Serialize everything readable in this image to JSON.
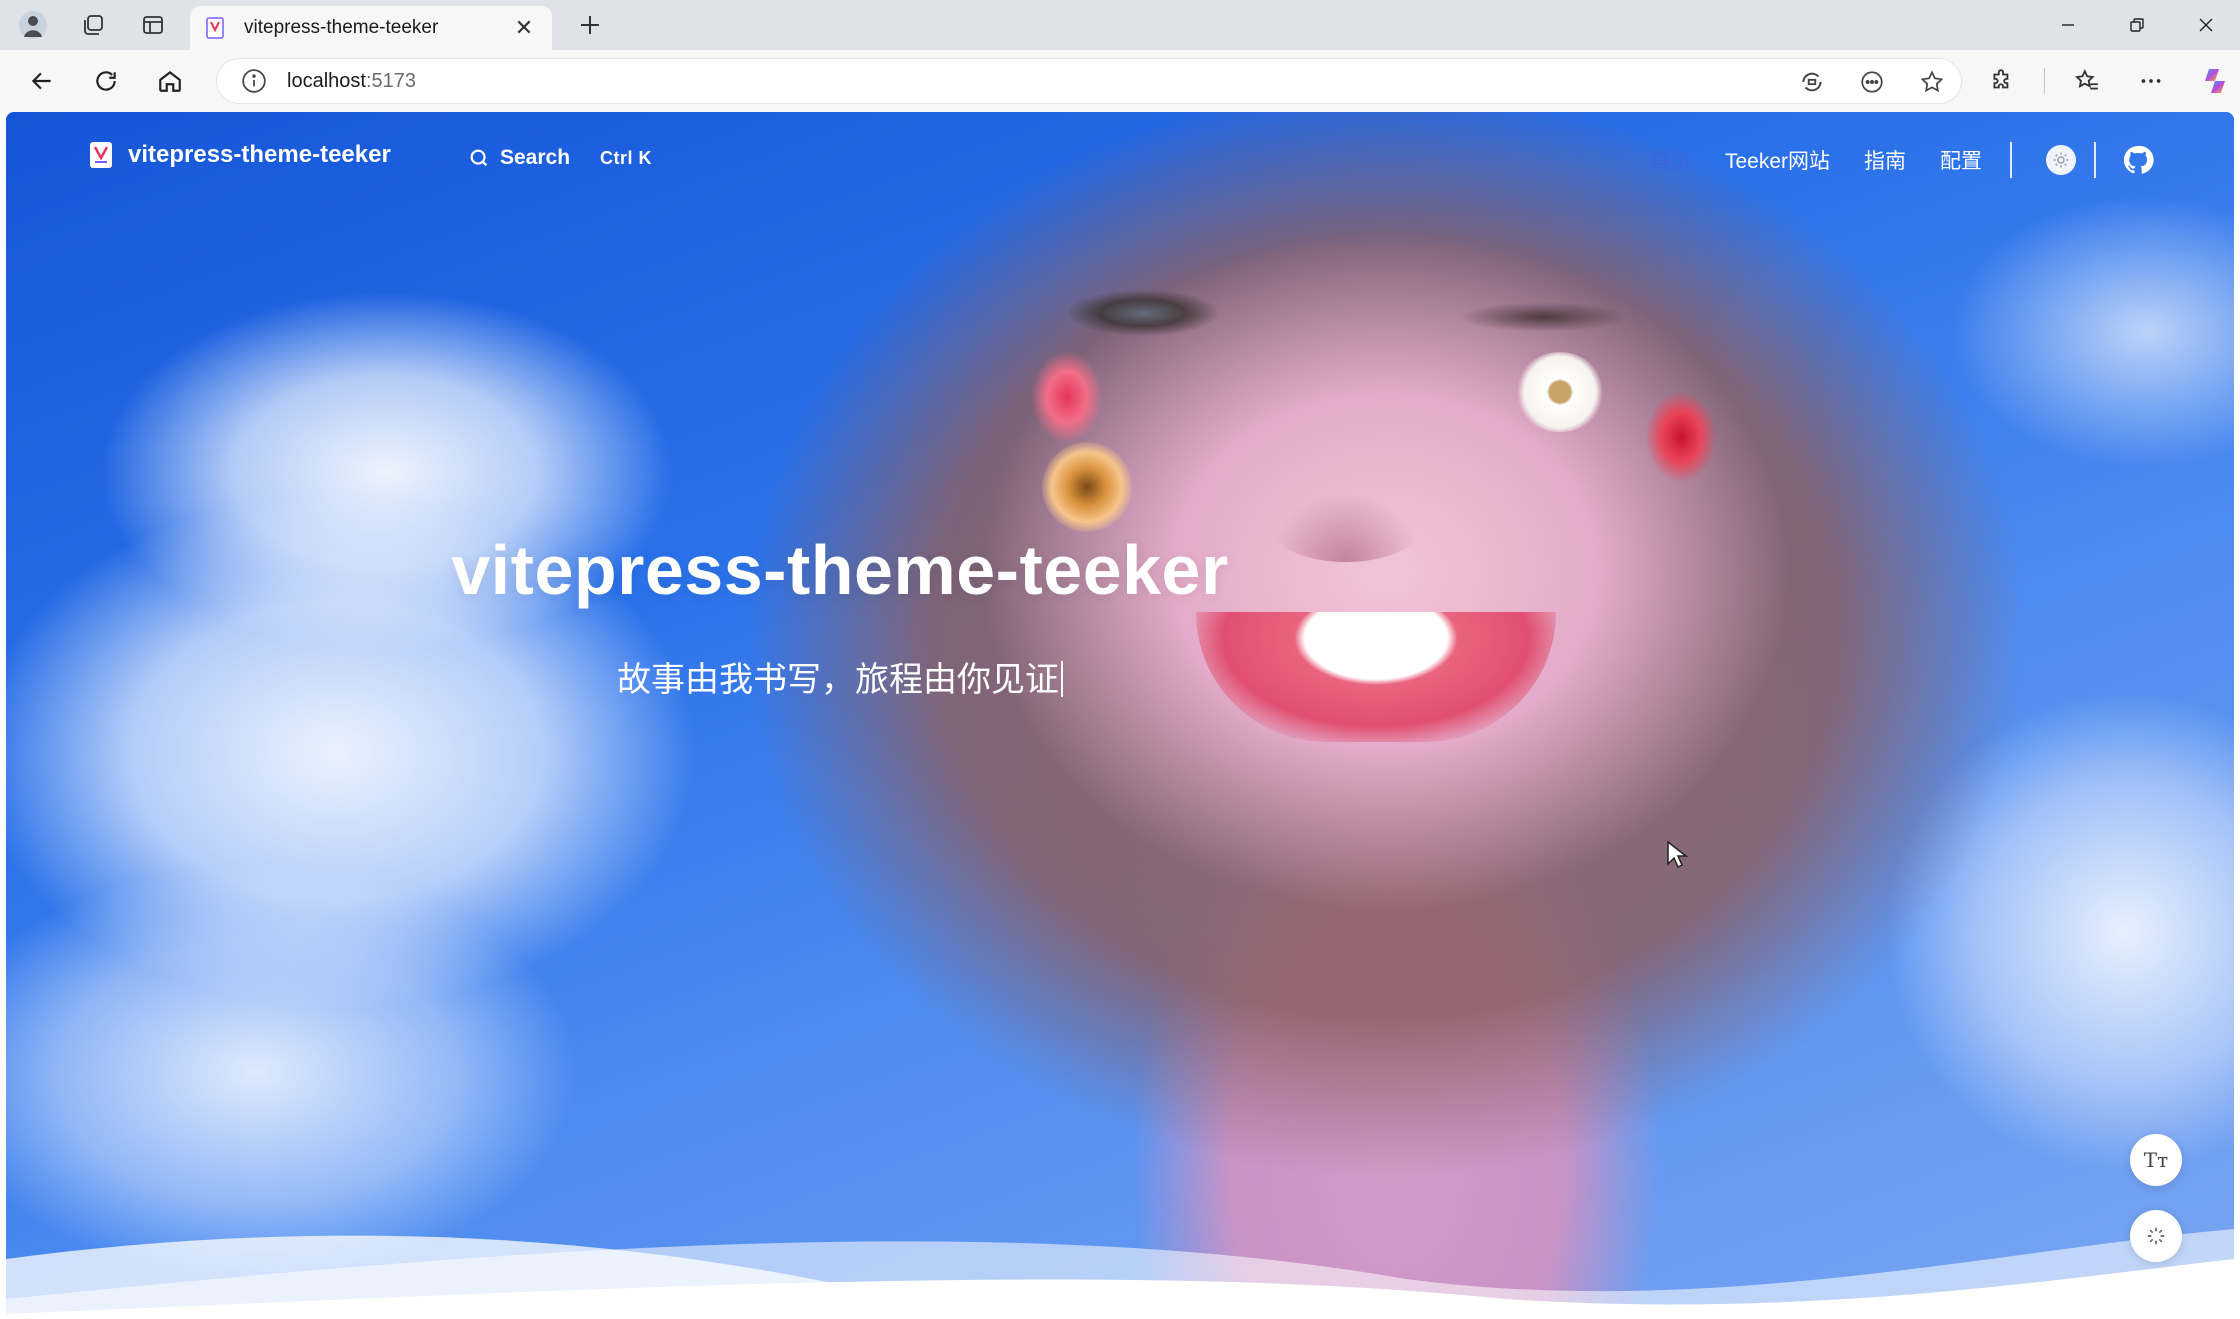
{
  "browser": {
    "tab": {
      "title": "vitepress-theme-teeker"
    },
    "address": {
      "host": "localhost",
      "port": ":5173"
    },
    "icons": {
      "profile": "profile-avatar-icon",
      "workspaces": "workspaces-icon",
      "tab_actions": "tab-actions-icon",
      "new_tab": "plus-icon",
      "back": "back-arrow-icon",
      "refresh": "refresh-icon",
      "home": "home-icon",
      "site_info": "info-icon",
      "read_aloud": "read-aloud-icon",
      "immersive": "immersive-reader-icon",
      "favorite": "star-icon",
      "extensions": "puzzle-icon",
      "favorites": "favorites-icon",
      "more": "more-icon",
      "copilot": "copilot-icon"
    }
  },
  "site": {
    "brand": "vitepress-theme-teeker",
    "search": {
      "label": "Search",
      "shortcut": "Ctrl K"
    },
    "nav": [
      {
        "label": "首页",
        "active": true
      },
      {
        "label": "Teeker网站",
        "active": false
      },
      {
        "label": "指南",
        "active": false
      },
      {
        "label": "配置",
        "active": false
      }
    ],
    "hero": {
      "title": "vitepress-theme-teeker",
      "description": "故事由我书写，旅程由你见证"
    },
    "float_buttons": {
      "font": "Tт",
      "effects": "sparkle-icon"
    },
    "colors": {
      "active_link": "#3e63dd",
      "text": "#ffffff",
      "sky": "#2b6fe0"
    }
  }
}
